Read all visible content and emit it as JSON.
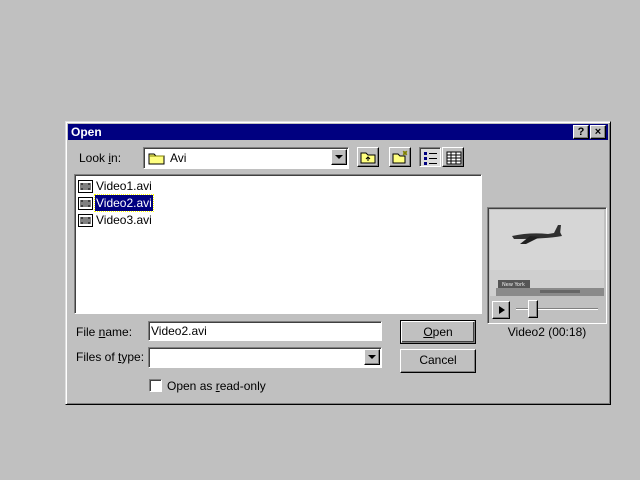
{
  "dialog": {
    "title": "Open",
    "help_label": "?",
    "close_label": "×"
  },
  "look_in": {
    "label_pre": "Look ",
    "label_u": "i",
    "label_post": "n:",
    "value": "Avi"
  },
  "files": [
    {
      "name": "Video1.avi",
      "selected": false
    },
    {
      "name": "Video2.avi",
      "selected": true
    },
    {
      "name": "Video3.avi",
      "selected": false
    }
  ],
  "file_name": {
    "label_pre": "File ",
    "label_u": "n",
    "label_post": "ame:",
    "value": "Video2.avi"
  },
  "files_of_type": {
    "label_pre": "Files of ",
    "label_u": "t",
    "label_post": "ype:",
    "value": ""
  },
  "read_only": {
    "label_pre": "Open as ",
    "label_u": "r",
    "label_post": "ead-only",
    "checked": false
  },
  "buttons": {
    "open_u": "O",
    "open_post": "pen",
    "cancel": "Cancel"
  },
  "preview": {
    "caption": "Video2 (00:18)",
    "sign_text": "New York",
    "play_icon": "play-icon",
    "position": 0.05
  },
  "colors": {
    "titlebar": "#000080",
    "face": "#c0c0c0",
    "selection": "#000080"
  }
}
